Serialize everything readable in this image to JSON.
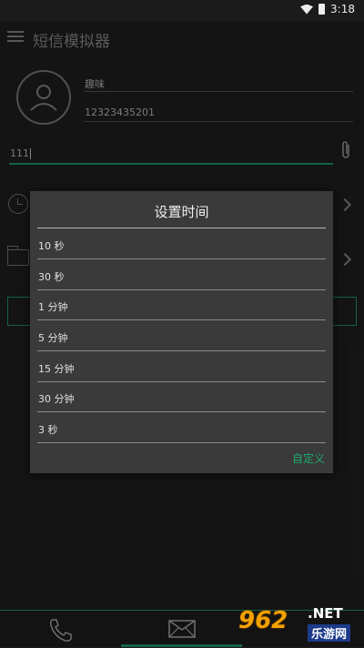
{
  "status_bar": {
    "time": "3:18"
  },
  "app": {
    "title": "短信模拟器"
  },
  "contact": {
    "name": "趣味",
    "phone": "12323435201"
  },
  "message": {
    "text": "111"
  },
  "dialog": {
    "title": "设置时间",
    "options": [
      "10 秒",
      "30 秒",
      "1 分钟",
      "5 分钟",
      "15 分钟",
      "30 分钟",
      "3 秒"
    ],
    "custom_label": "自定义"
  },
  "watermark": {
    "logo": "962",
    "suffix": ".NET",
    "site": "乐游网"
  },
  "colors": {
    "accent": "#1c8a5f",
    "background": "#1d1d1d",
    "dialog": "#3a3a3a"
  }
}
